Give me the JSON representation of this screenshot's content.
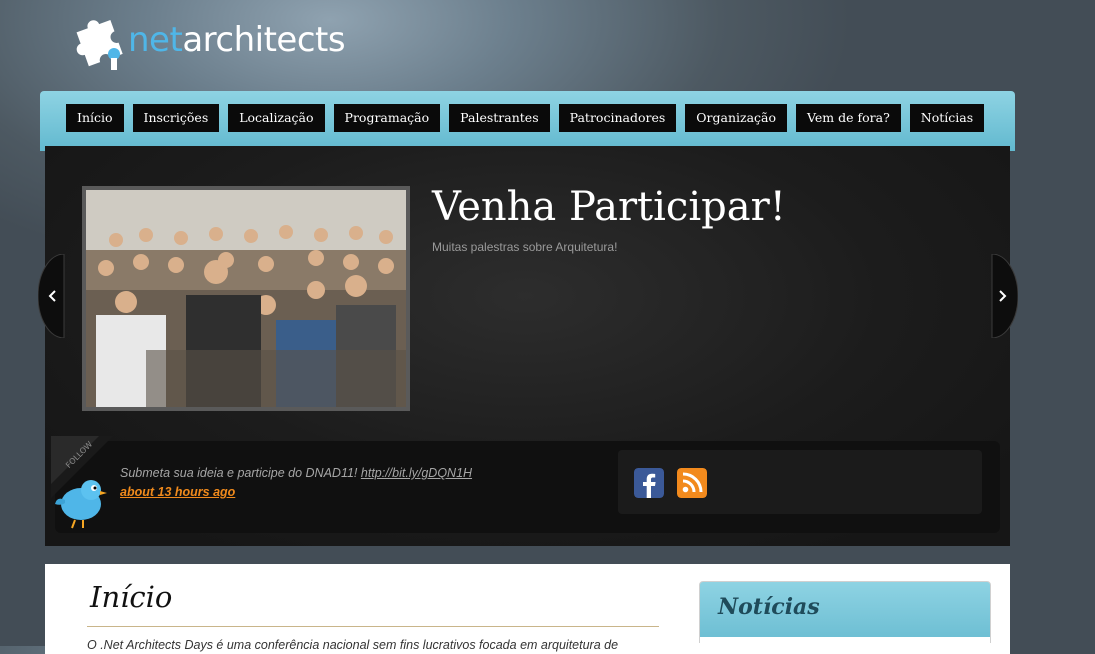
{
  "brand": {
    "logo_prefix": "net",
    "logo_suffix": "architects"
  },
  "nav": {
    "items": [
      {
        "label": "Início"
      },
      {
        "label": "Inscrições"
      },
      {
        "label": "Localização"
      },
      {
        "label": "Programação"
      },
      {
        "label": "Palestrantes"
      },
      {
        "label": "Patrocinadores"
      },
      {
        "label": "Organização"
      },
      {
        "label": "Vem de fora?"
      },
      {
        "label": "Notícias"
      }
    ]
  },
  "slider": {
    "title": "Venha Participar!",
    "subtitle": "Muitas palestras sobre Arquitetura!"
  },
  "twitter": {
    "badge": "FOLLOW",
    "tweet_text": "Submeta sua ideia e participe do DNAD11! ",
    "tweet_link": "http://bit.ly/gDQN1H",
    "time": "about 13 hours ago"
  },
  "social": {
    "icons": [
      "facebook-icon",
      "rss-icon"
    ],
    "colors": {
      "facebook": "#3b5998",
      "rss": "#f28a1d"
    }
  },
  "content": {
    "page_title": "Início",
    "body_text": "O .Net Architects Days é uma conferência nacional sem fins lucrativos focada em arquitetura de"
  },
  "sidebar": {
    "news_title": "Notícias"
  },
  "colors": {
    "accent": "#6cc1d6",
    "nav_bg": "#0a0a0a",
    "link": "#f08a1c"
  }
}
